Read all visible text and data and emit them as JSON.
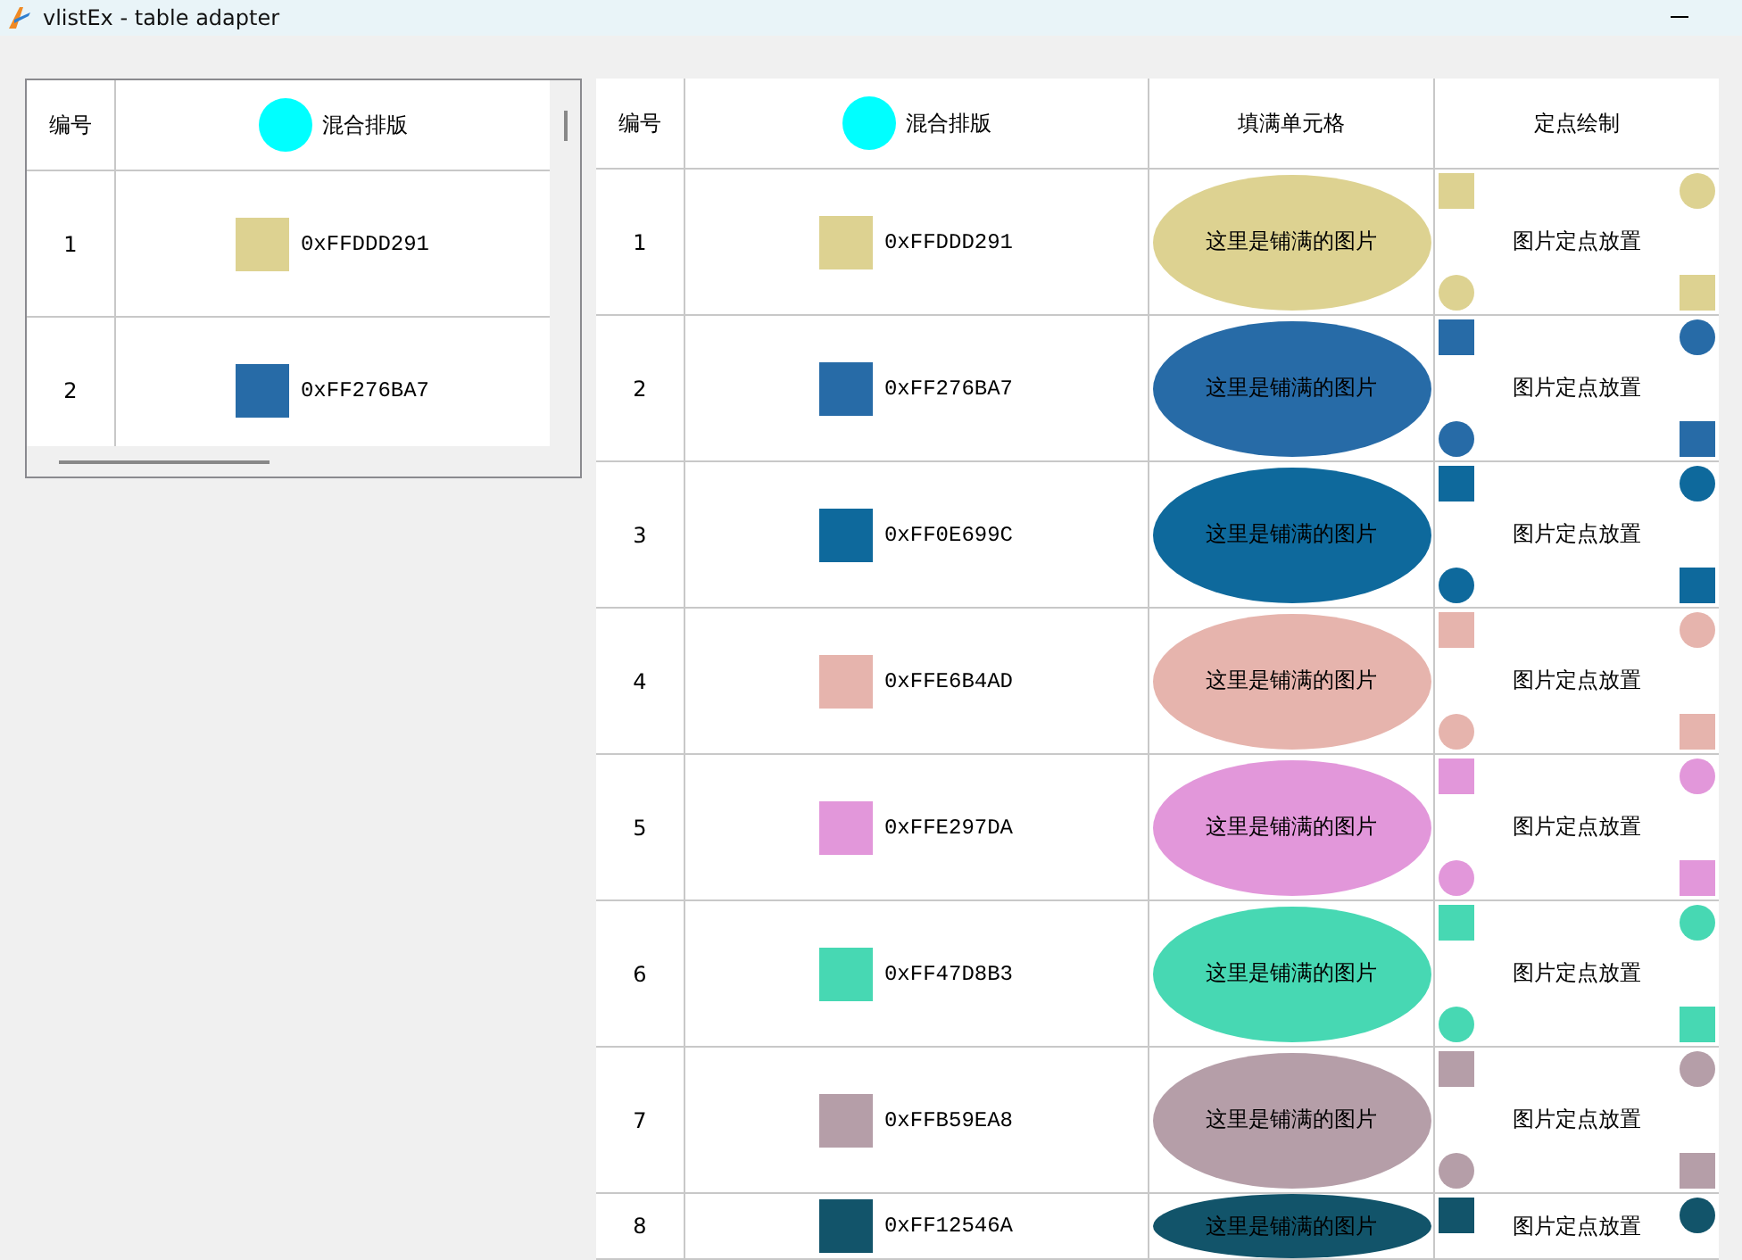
{
  "window": {
    "title": "vlistEx - table adapter"
  },
  "small_table": {
    "columns": [
      "编号",
      "混合排版"
    ],
    "rows": [
      {
        "number": "1",
        "code": "0xFFDDD291",
        "color": "#ddd291"
      },
      {
        "number": "2",
        "code": "0xFF276BA7",
        "color": "#276ba7"
      }
    ]
  },
  "table": {
    "columns": [
      "编号",
      "混合排版",
      "填满单元格",
      "定点绘制"
    ],
    "rows": [
      {
        "number": "1",
        "code": "0xFFDDD291",
        "color": "#ddd291",
        "fill_text": "这里是铺满的图片",
        "pin_text": "图片定点放置"
      },
      {
        "number": "2",
        "code": "0xFF276BA7",
        "color": "#276ba7",
        "fill_text": "这里是铺满的图片",
        "pin_text": "图片定点放置"
      },
      {
        "number": "3",
        "code": "0xFF0E699C",
        "color": "#0e699c",
        "fill_text": "这里是铺满的图片",
        "pin_text": "图片定点放置"
      },
      {
        "number": "4",
        "code": "0xFFE6B4AD",
        "color": "#e6b4ad",
        "fill_text": "这里是铺满的图片",
        "pin_text": "图片定点放置"
      },
      {
        "number": "5",
        "code": "0xFFE297DA",
        "color": "#e297da",
        "fill_text": "这里是铺满的图片",
        "pin_text": "图片定点放置"
      },
      {
        "number": "6",
        "code": "0xFF47D8B3",
        "color": "#47d8b3",
        "fill_text": "这里是铺满的图片",
        "pin_text": "图片定点放置"
      },
      {
        "number": "7",
        "code": "0xFFB59EA8",
        "color": "#b59ea8",
        "fill_text": "这里是铺满的图片",
        "pin_text": "图片定点放置"
      },
      {
        "number": "8",
        "code": "0xFF12546A",
        "color": "#12546a",
        "fill_text": "这里是铺满的图片",
        "pin_text": "图片定点放置"
      }
    ]
  }
}
